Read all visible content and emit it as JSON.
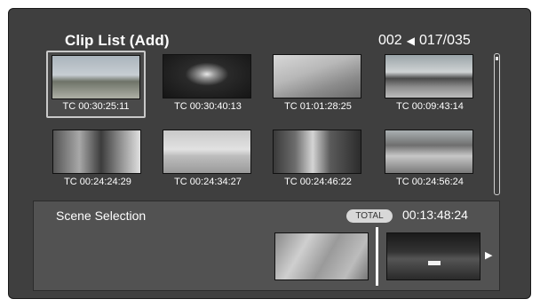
{
  "header": {
    "title": "Clip List (Add)",
    "clip_number": "002",
    "arrow_icon": "left-triangle-icon",
    "position": "017/035"
  },
  "clips": [
    {
      "timecode": "TC 00:30:25:11",
      "selected": true
    },
    {
      "timecode": "TC 00:30:40:13",
      "selected": false
    },
    {
      "timecode": "TC 01:01:28:25",
      "selected": false
    },
    {
      "timecode": "TC 00:09:43:14",
      "selected": false
    },
    {
      "timecode": "TC 00:24:24:29",
      "selected": false
    },
    {
      "timecode": "TC 00:24:34:27",
      "selected": false
    },
    {
      "timecode": "TC 00:24:46:22",
      "selected": false
    },
    {
      "timecode": "TC 00:24:56:24",
      "selected": false
    }
  ],
  "scene": {
    "label": "Scene Selection",
    "total_badge": "TOTAL",
    "total_time": "00:13:48:24",
    "next_icon": "right-triangle-icon"
  },
  "colors": {
    "background": "#3f3f3f",
    "panel": "#525252",
    "text": "#ffffff",
    "badge": "#d8d8d8"
  }
}
